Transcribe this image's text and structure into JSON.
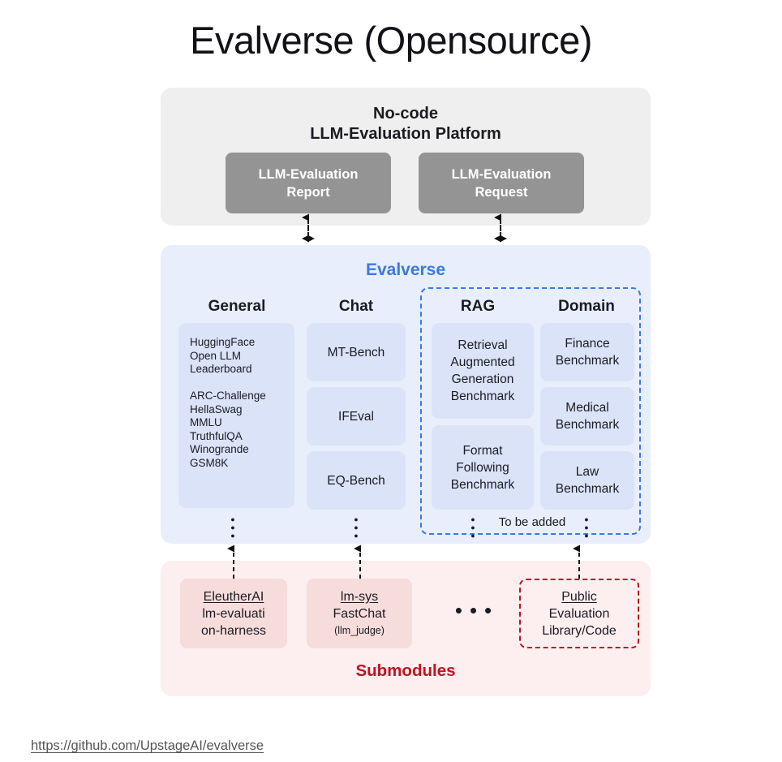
{
  "title": "Evalverse (Opensource)",
  "platform": {
    "heading": "No-code\nLLM-Evaluation Platform",
    "boxes": [
      {
        "label": "LLM-Evaluation\nReport"
      },
      {
        "label": "LLM-Evaluation\nRequest"
      }
    ],
    "bg_color": "#efefef",
    "box_color": "#949494"
  },
  "evalverse": {
    "heading": "Evalverse",
    "heading_color": "#3b7ae0",
    "bg_color": "#e8eefb",
    "box_color": "#dbe3f8",
    "dashed_border_color": "#3b7ae0",
    "to_be_added_label": "To be added",
    "columns": [
      {
        "title": "General",
        "items": [
          "HuggingFace\nOpen LLM\nLeaderboard\n\nARC-Challenge\nHellaSwag\nMMLU\nTruthfulQA\nWinogrande\nGSM8K"
        ],
        "ellipsis": "⋮"
      },
      {
        "title": "Chat",
        "items": [
          "MT-Bench",
          "IFEval",
          "EQ-Bench"
        ],
        "ellipsis": "⋮"
      },
      {
        "title": "RAG",
        "items": [
          "Retrieval\nAugmented\nGeneration\nBenchmark",
          "Format\nFollowing\nBenchmark"
        ],
        "ellipsis": "⋮"
      },
      {
        "title": "Domain",
        "items": [
          "Finance\nBenchmark",
          "Medical\nBenchmark",
          "Law\nBenchmark"
        ],
        "ellipsis": "⋮"
      }
    ]
  },
  "submodules": {
    "label": "Submodules",
    "label_color": "#c1121f",
    "bg_color": "#fdeef0",
    "box_color": "#f7dcdc",
    "dashed_border_color": "#c1121f",
    "horizontal_ellipsis": "•••",
    "boxes": [
      {
        "head": "EleutherAI",
        "body": "lm-evaluati\non-harness",
        "note": ""
      },
      {
        "head": "lm-sys",
        "body": "FastChat",
        "note": "(llm_judge)"
      },
      {
        "head": "Public",
        "body": "Evaluation\nLibrary/Code",
        "note": ""
      }
    ]
  },
  "footer": {
    "repo_url": "https://github.com/UpstageAI/evalverse"
  }
}
